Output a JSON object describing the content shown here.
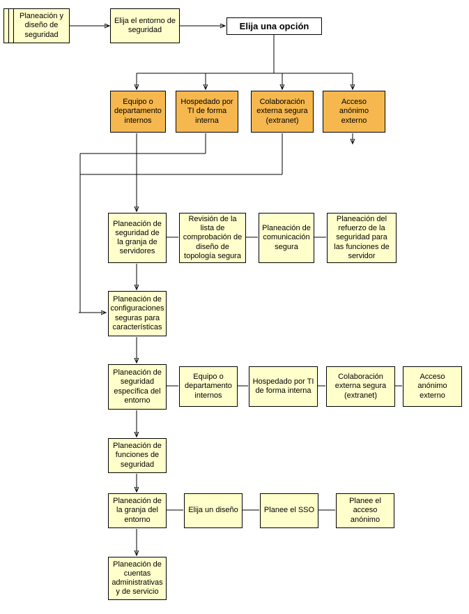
{
  "top": {
    "start": "Planeación y diseño de seguridad",
    "env": "Elija el entorno de seguridad",
    "choose": "Elija una opción"
  },
  "options": {
    "a": "Equipo o departamento internos",
    "b": "Hospedado por TI de forma interna",
    "c": "Colaboración externa segura (extranet)",
    "d": "Acceso anónimo externo"
  },
  "midrow": {
    "a": "Planeación de seguridad de la granja de servidores",
    "b": "Revisión de la lista de comprobación de diseño de topología segura",
    "c": "Planeación de comunicación segura",
    "d": "Planeación del refuerzo de la seguridad para las funciones de servidor"
  },
  "col": {
    "config": "Planeación de configuraciones seguras para características",
    "envsec": "Planeación de seguridad específica del entorno",
    "funcs": "Planeación de funciones de seguridad",
    "farm": "Planeación de la granja del entorno",
    "admin": "Planeación de cuentas administrativas y de servicio"
  },
  "envrow": {
    "a": "Equipo o departamento internos",
    "b": "Hospedado por TI de forma interna",
    "c": "Colaboración externa segura (extranet)",
    "d": "Acceso anónimo externo"
  },
  "farmrow": {
    "a": "Elija un diseño",
    "b": "Planee el SSO",
    "c": "Planee el acceso anónimo"
  }
}
